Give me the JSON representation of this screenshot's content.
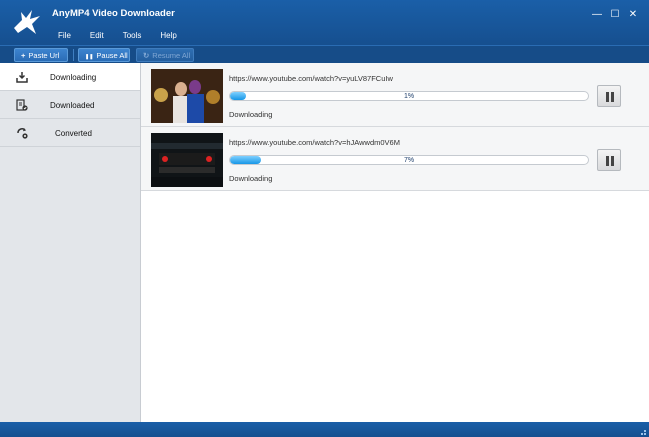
{
  "app": {
    "title": "AnyMP4 Video Downloader",
    "logo_icon": "bird-logo-icon"
  },
  "menu": {
    "items": [
      {
        "label": "File"
      },
      {
        "label": "Edit"
      },
      {
        "label": "Tools"
      },
      {
        "label": "Help"
      }
    ]
  },
  "window_controls": {
    "minimize": "—",
    "maximize": "☐",
    "close": "✕"
  },
  "toolbar": {
    "paste_url": {
      "icon": "+",
      "label": "Paste Url"
    },
    "pause_all": {
      "icon": "❚❚",
      "label": "Pause All"
    },
    "resume_all": {
      "icon": "↻",
      "label": "Resume All",
      "enabled": false
    }
  },
  "sidebar": {
    "items": [
      {
        "label": "Downloading",
        "icon": "download-icon",
        "active": true
      },
      {
        "label": "Downloaded",
        "icon": "downloaded-file-icon",
        "active": false
      },
      {
        "label": "Converted",
        "icon": "convert-icon",
        "active": false
      }
    ]
  },
  "downloads": [
    {
      "url": "https://www.youtube.com/watch?v=yuLV87FCuIw",
      "progress_percent": 1,
      "progress_label": "1%",
      "status": "Downloading",
      "thumbnail": "thumbnail-two-people"
    },
    {
      "url": "https://www.youtube.com/watch?v=hJAwwdm0V6M",
      "progress_percent": 7,
      "progress_label": "7%",
      "status": "Downloading",
      "thumbnail": "thumbnail-zest-vs-dear"
    }
  ],
  "colors": {
    "titlebar": "#1a5fa8",
    "toolbar": "#164c88",
    "progress_fill": "#1796e6",
    "sidebar_bg": "#e3e6ea"
  }
}
